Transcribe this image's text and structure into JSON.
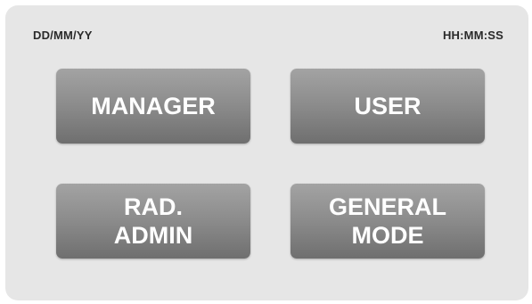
{
  "header": {
    "date": "DD/MM/YY",
    "time": "HH:MM:SS"
  },
  "buttons": [
    {
      "label": "MANAGER"
    },
    {
      "label": "USER"
    },
    {
      "label": "RAD.\nADMIN"
    },
    {
      "label": "GENERAL\nMODE"
    }
  ],
  "colors": {
    "panel": "#e6e6e6",
    "button_top": "#a3a3a3",
    "button_bottom": "#6f6f6f",
    "button_text": "#ffffff",
    "header_text": "#2a2a2a"
  }
}
